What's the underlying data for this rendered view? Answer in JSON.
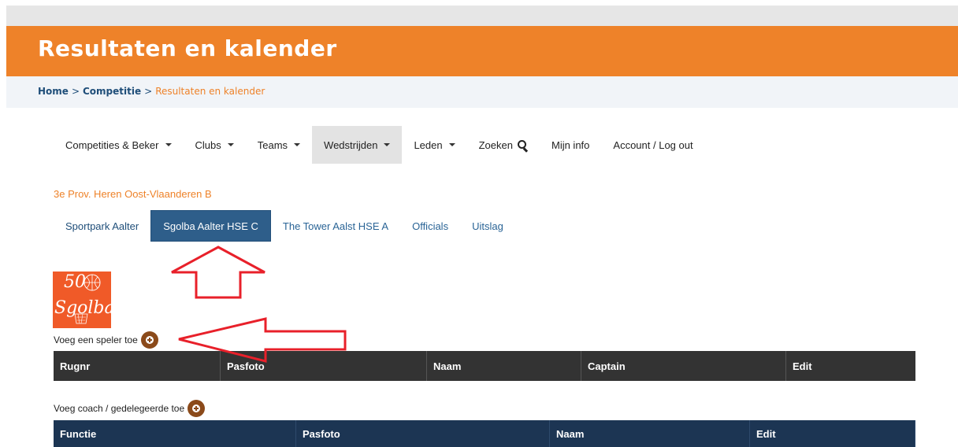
{
  "banner": {
    "title": "Resultaten en kalender"
  },
  "breadcrumb": {
    "home": "Home",
    "separator": ">",
    "competitie": "Competitie",
    "current": "Resultaten en kalender"
  },
  "nav": {
    "items": [
      {
        "label": "Competities & Beker",
        "dropdown": true
      },
      {
        "label": "Clubs",
        "dropdown": true
      },
      {
        "label": "Teams",
        "dropdown": true
      },
      {
        "label": "Wedstrijden",
        "dropdown": true,
        "active": true
      },
      {
        "label": "Leden",
        "dropdown": true
      },
      {
        "label": "Zoeken",
        "icon": "search-icon"
      },
      {
        "label": "Mijn info"
      },
      {
        "label": "Account / Log out"
      }
    ]
  },
  "division": "3e Prov. Heren Oost-Vlaanderen B",
  "subtabs": [
    {
      "label": "Sportpark Aalter"
    },
    {
      "label": "Sgolba Aalter HSE C",
      "active": true
    },
    {
      "label": "The Tower Aalst HSE A"
    },
    {
      "label": "Officials"
    },
    {
      "label": "Uitslag"
    }
  ],
  "logo": {
    "number": "50",
    "word": "Sgolba"
  },
  "players": {
    "add_label": "Voeg een speler toe",
    "columns": [
      "Rugnr",
      "Pasfoto",
      "Naam",
      "Captain",
      "Edit"
    ]
  },
  "coaches": {
    "add_label": "Voeg coach / gedelegeerde toe",
    "columns": [
      "Functie",
      "Pasfoto",
      "Naam",
      "Edit"
    ]
  },
  "colors": {
    "brand_orange": "#ee8229",
    "active_tab": "#2e5e8a",
    "add_button": "#8b4a1a",
    "players_header": "#333333",
    "coaches_header": "#1c3553",
    "annotation_arrow": "#e8202a"
  }
}
